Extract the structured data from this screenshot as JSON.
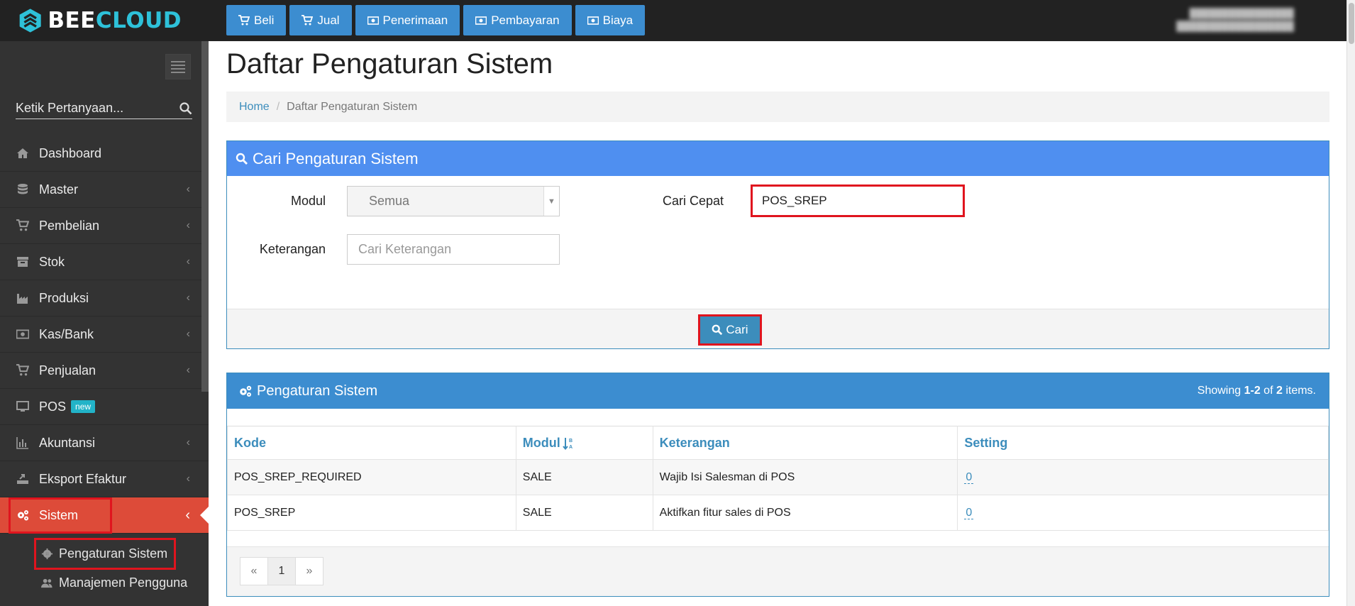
{
  "brand": {
    "name_part1": "BEE",
    "name_part2": "CLOUD"
  },
  "topnav": [
    {
      "label": "Beli",
      "icon": "cart-icon"
    },
    {
      "label": "Jual",
      "icon": "cart-icon"
    },
    {
      "label": "Penerimaan",
      "icon": "money-icon"
    },
    {
      "label": "Pembayaran",
      "icon": "money-icon"
    },
    {
      "label": "Biaya",
      "icon": "money-icon"
    }
  ],
  "sidebar": {
    "search_placeholder": "Ketik Pertanyaan...",
    "items": [
      {
        "label": "Dashboard",
        "icon": "home-icon",
        "has_chevron": false
      },
      {
        "label": "Master",
        "icon": "database-icon",
        "has_chevron": true
      },
      {
        "label": "Pembelian",
        "icon": "cart-icon",
        "has_chevron": true
      },
      {
        "label": "Stok",
        "icon": "archive-icon",
        "has_chevron": true
      },
      {
        "label": "Produksi",
        "icon": "factory-icon",
        "has_chevron": true
      },
      {
        "label": "Kas/Bank",
        "icon": "money-icon",
        "has_chevron": true
      },
      {
        "label": "Penjualan",
        "icon": "cart-icon",
        "has_chevron": true
      },
      {
        "label": "POS",
        "icon": "monitor-icon",
        "badge": "new",
        "has_chevron": false
      },
      {
        "label": "Akuntansi",
        "icon": "bar-chart-icon",
        "has_chevron": true
      },
      {
        "label": "Eksport Efaktur",
        "icon": "export-icon",
        "has_chevron": true
      },
      {
        "label": "Sistem",
        "icon": "gears-icon",
        "has_chevron": true,
        "active": true
      }
    ],
    "subitems": [
      {
        "label": "Pengaturan Sistem",
        "icon": "gear-icon"
      },
      {
        "label": "Manajemen Pengguna",
        "icon": "users-icon"
      }
    ]
  },
  "page": {
    "title": "Daftar Pengaturan Sistem",
    "breadcrumb": {
      "home": "Home",
      "current": "Daftar Pengaturan Sistem"
    }
  },
  "search_panel": {
    "title": "Cari Pengaturan Sistem",
    "modul_label": "Modul",
    "modul_value": "Semua",
    "keterangan_label": "Keterangan",
    "keterangan_placeholder": "Cari Keterangan",
    "cari_cepat_label": "Cari Cepat",
    "cari_cepat_value": "POS_SREP",
    "submit_label": "Cari"
  },
  "results_panel": {
    "title": "Pengaturan Sistem",
    "showing_prefix": "Showing ",
    "showing_range": "1-2",
    "showing_mid": " of ",
    "showing_total": "2",
    "showing_suffix": " items.",
    "columns": [
      "Kode",
      "Modul",
      "Keterangan",
      "Setting"
    ],
    "rows": [
      {
        "kode": "POS_SREP_REQUIRED",
        "modul": "SALE",
        "keterangan": "Wajib Isi Salesman di POS",
        "setting": "0"
      },
      {
        "kode": "POS_SREP",
        "modul": "SALE",
        "keterangan": "Aktifkan fitur sales di POS",
        "setting": "0"
      }
    ],
    "pagination": {
      "prev": "«",
      "current": "1",
      "next": "»"
    }
  },
  "colors": {
    "topbar": "#222222",
    "sidebar": "#333333",
    "active_menu": "#dd4b39",
    "primary": "#3c8dbc",
    "highlight_box": "#e0141e",
    "brand_accent": "#2ec1d9"
  }
}
